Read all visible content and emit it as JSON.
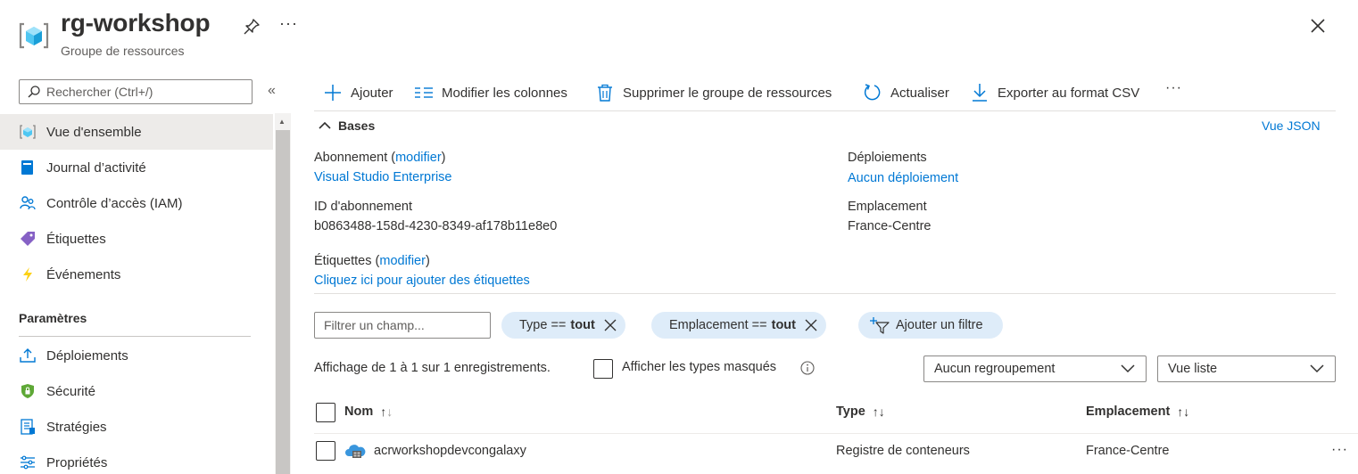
{
  "header": {
    "title": "rg-workshop",
    "subtitle": "Groupe de ressources",
    "more_label": "···"
  },
  "sidebar": {
    "search_placeholder": "Rechercher (Ctrl+/)",
    "collapse_label": "«",
    "items": [
      {
        "label": "Vue d'ensemble",
        "icon": "resource-group-icon",
        "active": true
      },
      {
        "label": "Journal d’activité",
        "icon": "activity-log-icon"
      },
      {
        "label": "Contrôle d’accès (IAM)",
        "icon": "iam-people-icon"
      },
      {
        "label": "Étiquettes",
        "icon": "tag-icon"
      },
      {
        "label": "Événements",
        "icon": "lightning-icon"
      }
    ],
    "section_title": "Paramètres",
    "settings_items": [
      {
        "label": "Déploiements",
        "icon": "upload-icon"
      },
      {
        "label": "Sécurité",
        "icon": "shield-icon"
      },
      {
        "label": "Stratégies",
        "icon": "policy-icon"
      },
      {
        "label": "Propriétés",
        "icon": "properties-icon"
      }
    ]
  },
  "toolbar": {
    "add": "Ajouter",
    "edit_columns": "Modifier les colonnes",
    "delete_group": "Supprimer le groupe de ressources",
    "refresh": "Actualiser",
    "export_csv": "Exporter au format CSV",
    "more": "···"
  },
  "essentials": {
    "section_label": "Bases",
    "json_view": "Vue JSON",
    "subscription_label": "Abonnement",
    "modify": "modifier",
    "subscription_value": "Visual Studio Enterprise",
    "subscription_id_label": "ID d'abonnement",
    "subscription_id_value": "b0863488-158d-4230-8349-af178b11e8e0",
    "tags_label": "Étiquettes",
    "tags_value": "Cliquez ici pour ajouter des étiquettes",
    "deployments_label": "Déploiements",
    "deployments_value": "Aucun déploiement",
    "location_label": "Emplacement",
    "location_value": "France-Centre"
  },
  "filters": {
    "field_placeholder": "Filtrer un champ...",
    "type_filter_label": "Type ==",
    "type_filter_value": "tout",
    "location_filter_label": "Emplacement ==",
    "location_filter_value": "tout",
    "add_filter": "Ajouter un filtre"
  },
  "list": {
    "records_text": "Affichage de 1 à 1 sur 1 enregistrements.",
    "show_hidden_label": "Afficher les types masqués",
    "grouping": "Aucun regroupement",
    "view_mode": "Vue liste",
    "columns": {
      "name": "Nom",
      "type": "Type",
      "location": "Emplacement"
    },
    "rows": [
      {
        "name": "acrworkshopdevcongalaxy",
        "type": "Registre de conteneurs",
        "location": "France-Centre"
      }
    ]
  },
  "colors": {
    "accent": "#0078d4",
    "pill_bg": "#deecf9",
    "active_nav": "#edebe9"
  }
}
